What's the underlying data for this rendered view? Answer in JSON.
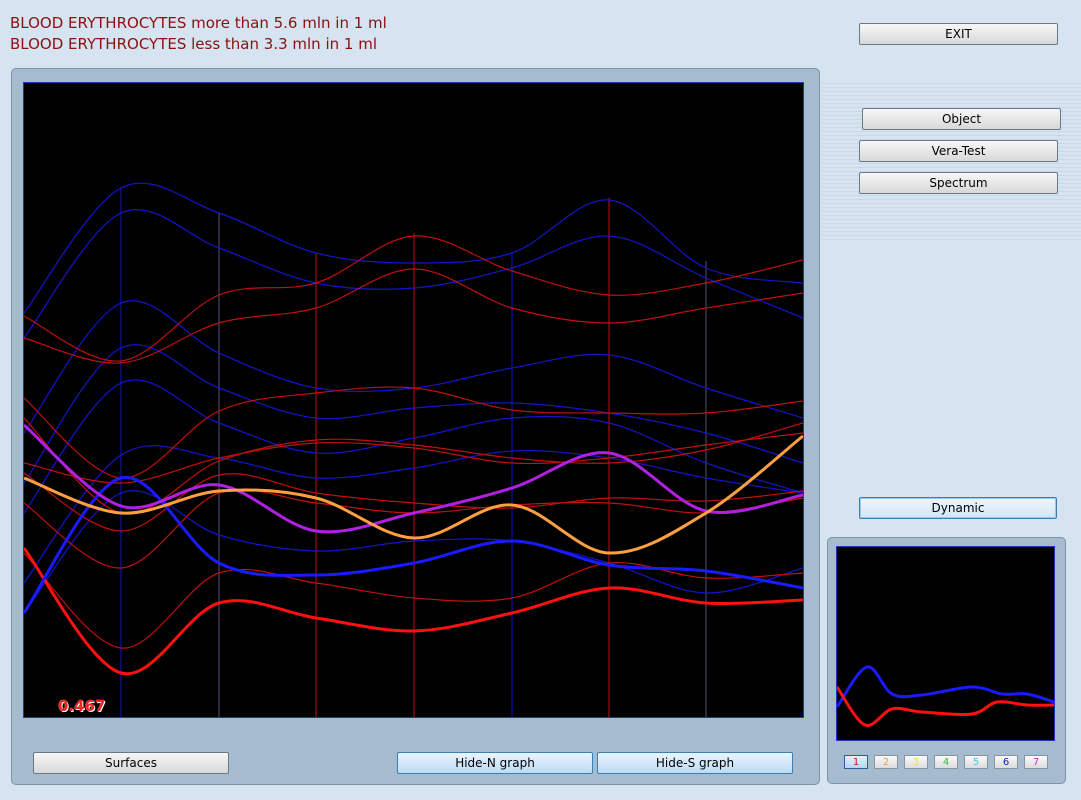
{
  "alerts": [
    "BLOOD ERYTHROCYTES more than 5.6 mln in 1 ml",
    "BLOOD ERYTHROCYTES less than 3.3 mln in 1 ml"
  ],
  "buttons": {
    "exit": "EXIT",
    "object": "Object",
    "vera_test": "Vera-Test",
    "spectrum": "Spectrum",
    "dynamic": "Dynamic",
    "surfaces": "Surfaces",
    "hide_n": "Hide-N graph",
    "hide_s": "Hide-S graph"
  },
  "graph": {
    "readout": "0.467"
  },
  "tabs": [
    {
      "label": "1",
      "color": "#d01010"
    },
    {
      "label": "2",
      "color": "#f0a040"
    },
    {
      "label": "3",
      "color": "#e8e040"
    },
    {
      "label": "4",
      "color": "#30c030"
    },
    {
      "label": "5",
      "color": "#40c8e8"
    },
    {
      "label": "6",
      "color": "#1010c0"
    },
    {
      "label": "7",
      "color": "#c030c0"
    }
  ],
  "colors": {
    "blue_curve": "#1515cc",
    "red_curve": "#c01010",
    "highlight_blue": "#1a1aff",
    "highlight_red": "#ff1010",
    "magenta": "#b020e0",
    "orange": "#ffa040"
  }
}
